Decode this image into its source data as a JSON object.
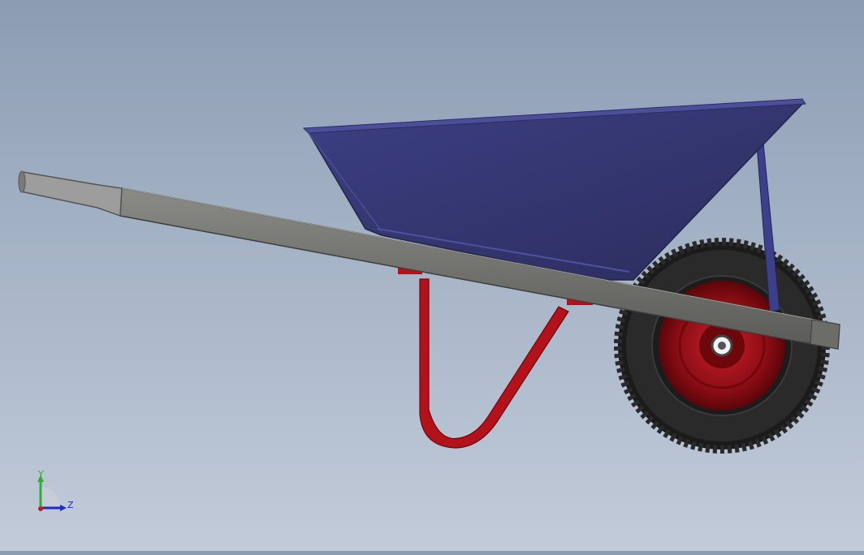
{
  "view": {
    "type": "3d-cad-viewport",
    "model": "wheelbarrow",
    "background_top": "#8c9cb2",
    "background_bottom": "#c2cbd9"
  },
  "colors": {
    "tray": "#36396f",
    "tray_rim": "#4a4d96",
    "handle": "#7a7a77",
    "grip": "#9d9d9d",
    "leg": "#b3121a",
    "wheel_rim": "#a0121a",
    "tire": "#1b1b1b"
  },
  "triad": {
    "y_label": "Y",
    "z_label": "Z",
    "y_color": "#2fae35",
    "z_color": "#1c2bcc",
    "x_color": "#c21c1c"
  }
}
